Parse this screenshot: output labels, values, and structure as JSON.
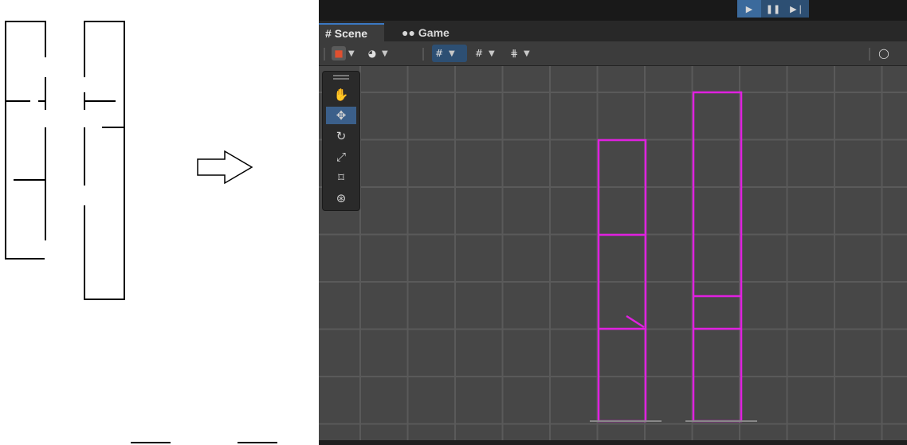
{
  "editor": {
    "tabs": [
      {
        "label": "Scene",
        "icon": "grid-hash-icon"
      },
      {
        "label": "Game",
        "icon": "gamepad-icon"
      }
    ],
    "play_controls": [
      "play-icon",
      "pause-icon",
      "step-icon"
    ],
    "toolbar_icons": [
      "draw-mode-icon",
      "shading-icon",
      "grid-toggle-icon",
      "snap-icon",
      "increment-snap-icon",
      "gizmo-icon"
    ],
    "tools": [
      "hand-tool-icon",
      "move-tool-icon",
      "rotate-tool-icon",
      "scale-tool-icon",
      "rect-tool-icon",
      "transform-tool-icon"
    ],
    "colors": {
      "wall_lines": "#e020e0",
      "grid_background": "#474747",
      "active_blue": "#3b6a9c"
    }
  },
  "sketch": {
    "arrow": "arrow-right-icon"
  }
}
